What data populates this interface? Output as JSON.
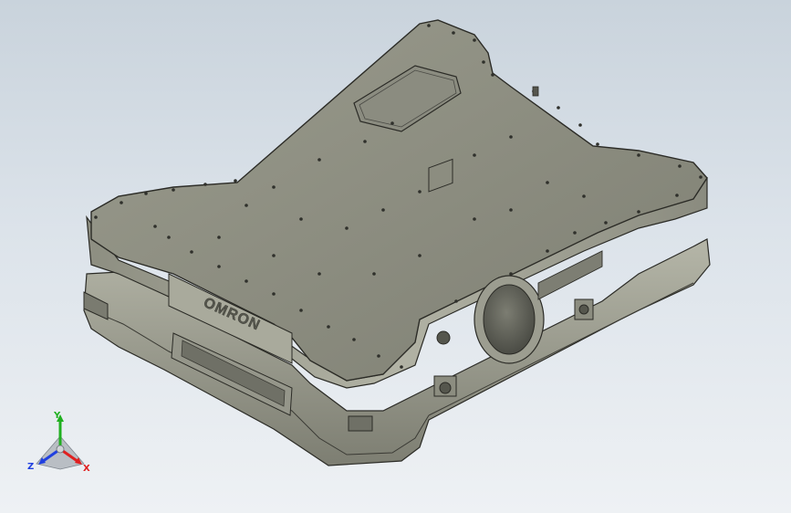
{
  "model": {
    "logo_text": "OMRON",
    "colors": {
      "body_top": "#8e8f82",
      "body_side": "#a8a99c",
      "body_dark": "#6f7066",
      "edge": "#2b2b26",
      "background_top": "#c9d3dc",
      "background_bottom": "#eef1f4"
    }
  },
  "triad": {
    "x_label": "X",
    "y_label": "Y",
    "z_label": "Z",
    "x_color": "#e02020",
    "y_color": "#20b020",
    "z_color": "#2040e0"
  }
}
